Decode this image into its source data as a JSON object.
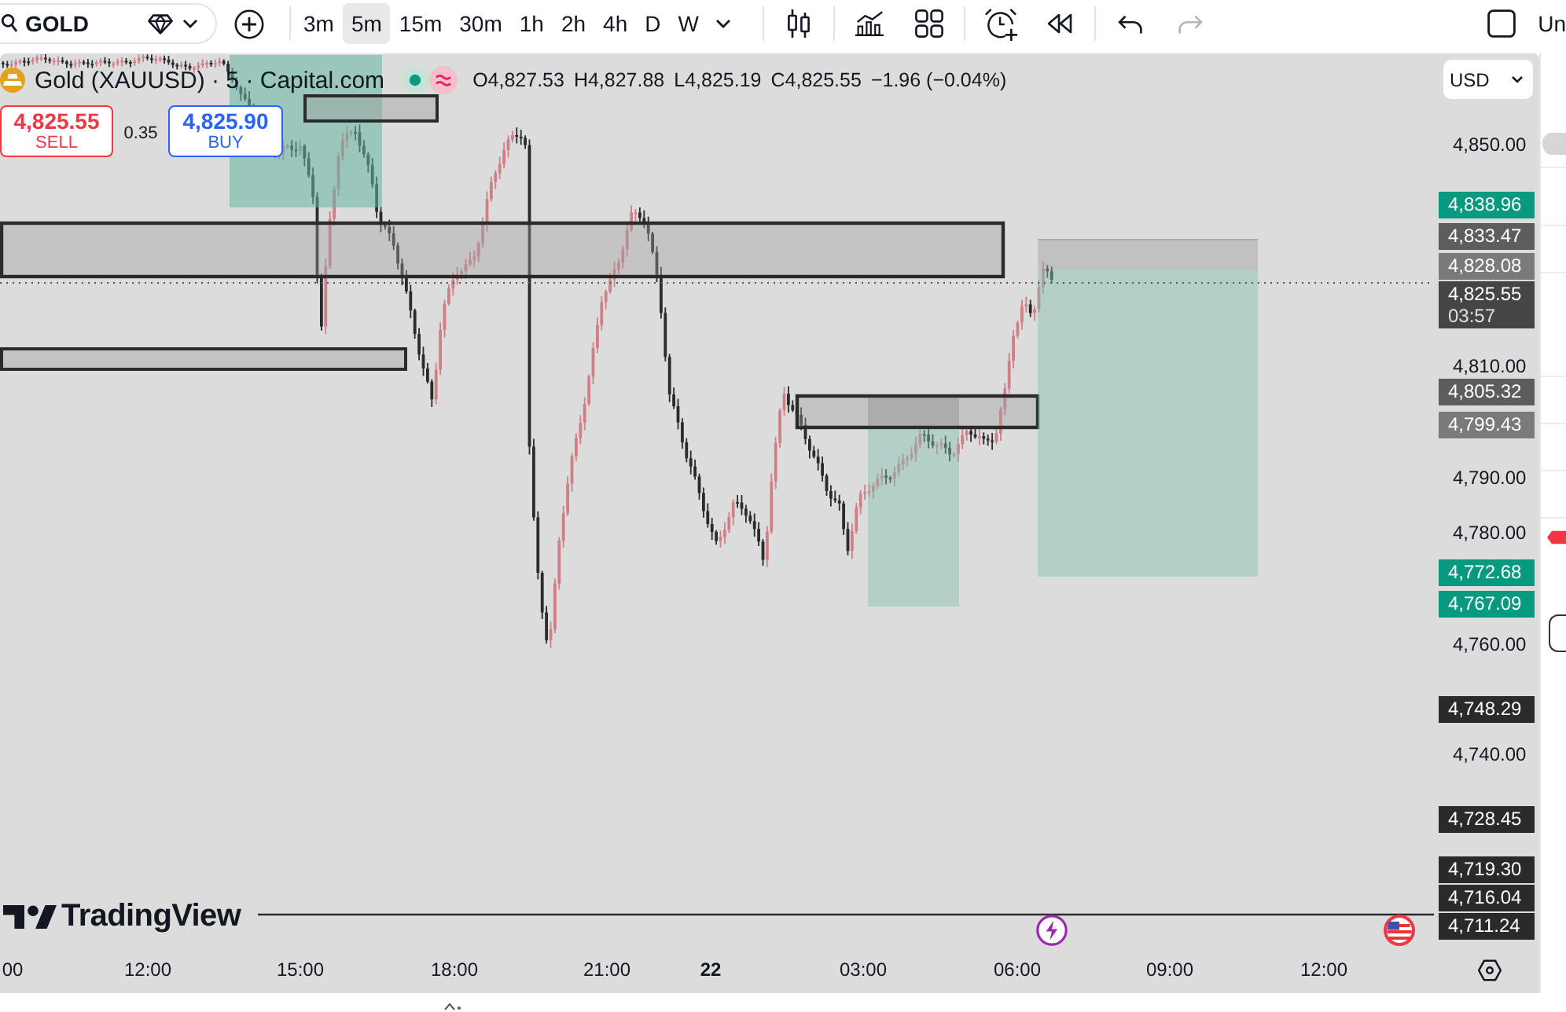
{
  "toolbar": {
    "symbol": "GOLD",
    "intervals": [
      {
        "label": "3m",
        "selected": false
      },
      {
        "label": "5m",
        "selected": true
      },
      {
        "label": "15m",
        "selected": false
      },
      {
        "label": "30m",
        "selected": false
      },
      {
        "label": "1h",
        "selected": false
      },
      {
        "label": "2h",
        "selected": false
      },
      {
        "label": "4h",
        "selected": false
      },
      {
        "label": "D",
        "selected": false
      },
      {
        "label": "W",
        "selected": false
      }
    ],
    "tool_groups": [
      [
        {
          "kind": "candles",
          "disabled": false
        }
      ],
      [
        {
          "kind": "indicators",
          "disabled": false
        },
        {
          "kind": "templates",
          "disabled": false
        }
      ],
      [
        {
          "kind": "alert",
          "disabled": false
        },
        {
          "kind": "replay",
          "disabled": false
        }
      ],
      [
        {
          "kind": "undo",
          "disabled": false
        },
        {
          "kind": "redo",
          "disabled": true
        }
      ]
    ],
    "right_label": "Un"
  },
  "legend": {
    "title": "Gold (XAUUSD) · 5 · Capital.com",
    "ohlc": [
      "O4,827.53",
      "H4,827.88",
      "L4,825.19",
      "C4,825.55"
    ],
    "change": "−1.96 (−0.04%)"
  },
  "trade": {
    "sell_price": "4,825.55",
    "sell_label": "SELL",
    "spread": "0.35",
    "buy_price": "4,825.90",
    "buy_label": "BUY"
  },
  "logo": "TradingView",
  "price_axis": {
    "currency": "USD",
    "ticks": [
      "4,850.00",
      "4,810.00",
      "4,790.00",
      "4,780.00",
      "4,760.00",
      "4,740.00"
    ],
    "labels": [
      {
        "price": "4,838.96",
        "color": "#089981"
      },
      {
        "price": "4,833.47",
        "color": "#5d5d5d"
      },
      {
        "price": "4,828.08",
        "color": "#7a7a7a"
      },
      {
        "price": "4,825.55",
        "countdown": "03:57",
        "color": "#454545"
      },
      {
        "price": "4,805.32",
        "color": "#5d5d5d"
      },
      {
        "price": "4,799.43",
        "color": "#7a7a7a"
      },
      {
        "price": "4,772.68",
        "color": "#089981"
      },
      {
        "price": "4,767.09",
        "color": "#089981"
      },
      {
        "price": "4,748.29",
        "color": "#2a2a2a"
      },
      {
        "price": "4,728.45",
        "color": "#2a2a2a"
      },
      {
        "price": "4,719.30",
        "color": "#2a2a2a"
      },
      {
        "price": "4,716.04",
        "color": "#2a2a2a"
      },
      {
        "price": "4,711.24",
        "color": "#2a2a2a"
      }
    ]
  },
  "time_axis": {
    "labels": [
      {
        "text": "00",
        "kind": "time"
      },
      {
        "text": "12:00",
        "kind": "time"
      },
      {
        "text": "15:00",
        "kind": "time"
      },
      {
        "text": "18:00",
        "kind": "time"
      },
      {
        "text": "21:00",
        "kind": "time"
      },
      {
        "text": "22",
        "kind": "day"
      },
      {
        "text": "03:00",
        "kind": "time"
      },
      {
        "text": "06:00",
        "kind": "time"
      },
      {
        "text": "09:00",
        "kind": "time"
      },
      {
        "text": "12:00",
        "kind": "time"
      }
    ]
  }
}
